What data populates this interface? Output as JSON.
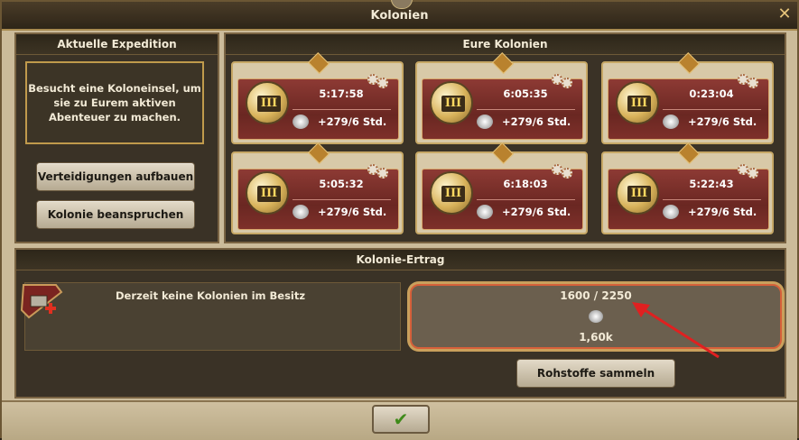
{
  "window": {
    "title": "Kolonien",
    "close_label": "✕"
  },
  "expedition": {
    "header": "Aktuelle Expedition",
    "info": "Besucht eine Koloneinsel, um sie zu Eurem aktiven Abenteuer zu machen.",
    "defend_button": "Verteidigungen aufbauen",
    "claim_button": "Kolonie beanspruchen"
  },
  "colonies": {
    "header": "Eure Kolonien",
    "items": [
      {
        "tier": "III",
        "timer": "5:17:58",
        "rate": "+279/6 Std."
      },
      {
        "tier": "III",
        "timer": "6:05:35",
        "rate": "+279/6 Std."
      },
      {
        "tier": "III",
        "timer": "0:23:04",
        "rate": "+279/6 Std."
      },
      {
        "tier": "III",
        "timer": "5:05:32",
        "rate": "+279/6 Std."
      },
      {
        "tier": "III",
        "timer": "6:18:03",
        "rate": "+279/6 Std."
      },
      {
        "tier": "III",
        "timer": "5:22:43",
        "rate": "+279/6 Std."
      }
    ]
  },
  "yield": {
    "header": "Kolonie-Ertrag",
    "no_colonies": "Derzeit keine Kolonien im Besitz",
    "storage": "1600 / 2250",
    "total": "1,60k",
    "collect_button": "Rohstoffe sammeln"
  },
  "footer": {
    "confirm_icon": "check-icon"
  },
  "colors": {
    "accent_red": "#e02020",
    "card_red": "#7a2e28",
    "gold": "#c7a866"
  }
}
